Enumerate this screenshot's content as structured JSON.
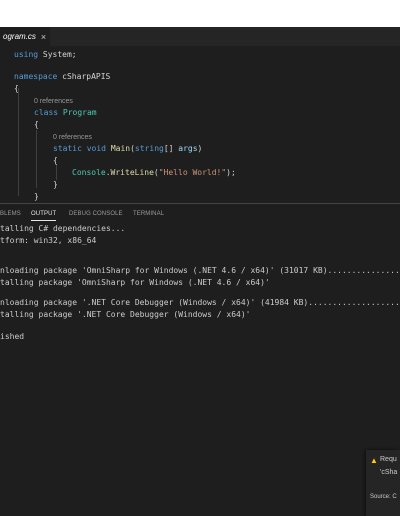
{
  "editor_tab": {
    "filename": "ogram.cs",
    "close_glyph": "×"
  },
  "code": {
    "using_kw": "using",
    "using_ns": " System;",
    "namespace_kw": "namespace",
    "namespace_name": " cSharpAPIS",
    "brace_open": "{",
    "brace_close": "}",
    "lens_class": "0 references",
    "class_kw": "class",
    "class_name": " Program",
    "lens_method": "0 references",
    "static_kw": "static",
    "void_kw": " void",
    "main_name": " Main",
    "paren_open": "(",
    "string_kw": "string",
    "array_brackets": "[] ",
    "args_name": "args",
    "paren_close": ")",
    "console_name": "Console",
    "dot": ".",
    "writeline_name": "WriteLine",
    "call_open": "(",
    "hello_str": "\"Hello World!\"",
    "call_close": ");"
  },
  "panel": {
    "tabs": [
      "BLEMS",
      "OUTPUT",
      "DEBUG CONSOLE",
      "TERMINAL"
    ],
    "active_tab": "OUTPUT"
  },
  "output_lines": [
    "talling C# dependencies...",
    "tform: win32, x86_64",
    "",
    "nloading package 'OmniSharp for Windows (.NET 4.6 / x64)' (31017 KB)...............",
    "talling package 'OmniSharp for Windows (.NET 4.6 / x64)'",
    "",
    "nloading package '.NET Core Debugger (Windows / x64)' (41984 KB)...................",
    "talling package '.NET Core Debugger (Windows / x64)'",
    "",
    "ished"
  ],
  "notification": {
    "icon": "warning-icon",
    "line1": "Requ",
    "line2": "'cSha",
    "source": "Source: C"
  },
  "colors": {
    "editor_bg": "#1e1e1e",
    "keyword": "#569cd6",
    "type": "#4ec9b0",
    "function": "#dcdcaa",
    "string": "#ce9178",
    "parameter": "#9cdcfe",
    "warning": "#ffcc00"
  }
}
